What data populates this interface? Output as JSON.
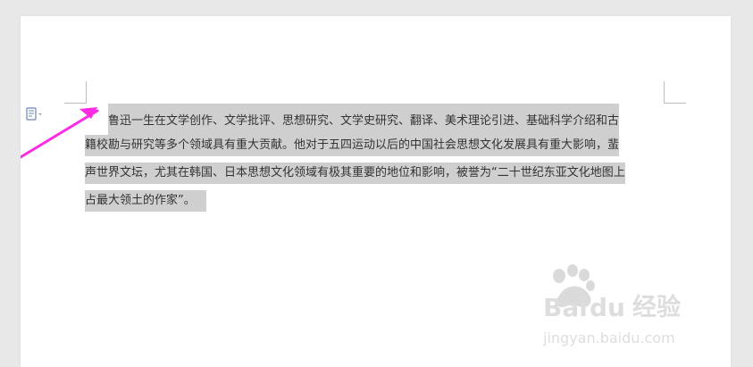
{
  "document": {
    "paragraph_lines": [
      "鲁迅一生在文学创作、文学批评、思想研究、文学史研究、翻译、美术理论引进、基础科学介绍和古",
      "籍校勘与研究等多个领域具有重大贡献。他对于五四运动以后的中国社会思想文化发展具有重大影响，蜚",
      "声世界文坛，尤其在韩国、日本思想文化领域有极其重要的地位和影响，被誉为“二十世纪东亚文化地图上",
      "占最大领土的作家”。"
    ]
  },
  "watermark": {
    "brand": "Bai",
    "brand_suffix": "du",
    "product": "经验",
    "url": "jingyan.baidu.com"
  },
  "ui": {
    "paste_icon": "paste-options-icon",
    "dropdown_icon": "chevron-down-icon",
    "annotation_color": "#ff2ce6",
    "selection_color": "#cfcfcf"
  }
}
